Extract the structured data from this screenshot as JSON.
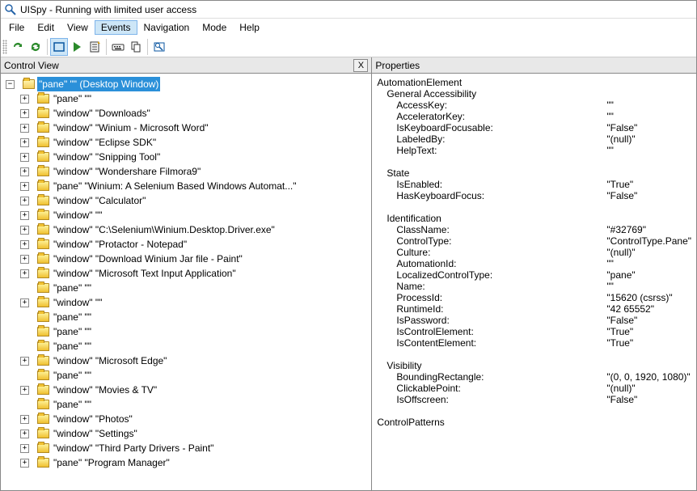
{
  "title": "UISpy - Running with limited user access",
  "menu": {
    "file": "File",
    "edit": "Edit",
    "view": "View",
    "events": "Events",
    "navigation": "Navigation",
    "mode": "Mode",
    "help": "Help",
    "active": "events"
  },
  "toolbar": [
    {
      "name": "refresh-icon",
      "svg": "refresh",
      "color": "#2b8a2b"
    },
    {
      "name": "refresh-all-icon",
      "svg": "refresh2",
      "color": "#2b8a2b"
    },
    {
      "sep": true
    },
    {
      "name": "rect-icon",
      "svg": "rect",
      "color": "#0a56a0",
      "active": true
    },
    {
      "name": "play-icon",
      "svg": "play",
      "color": "#2b8a2b"
    },
    {
      "name": "sheet-icon",
      "svg": "sheet",
      "color": "#333"
    },
    {
      "sep": true
    },
    {
      "name": "keyboard-icon",
      "svg": "keyboard",
      "color": "#333"
    },
    {
      "name": "copy-icon",
      "svg": "copy",
      "color": "#333"
    },
    {
      "sep": true
    },
    {
      "name": "target-icon",
      "svg": "target",
      "color": "#0a56a0"
    }
  ],
  "panes": {
    "left_title": "Control View",
    "right_title": "Properties",
    "close_label": "X"
  },
  "tree": {
    "root": {
      "label": "\"pane\" \"\" (Desktop Window)",
      "selected": true,
      "expanded": true
    },
    "children": [
      {
        "exp": "+",
        "label": "\"pane\" \"\""
      },
      {
        "exp": "+",
        "label": "\"window\" \"Downloads\""
      },
      {
        "exp": "+",
        "label": "\"window\" \"Winium - Microsoft Word\""
      },
      {
        "exp": "+",
        "label": "\"window\" \"Eclipse SDK\""
      },
      {
        "exp": "+",
        "label": "\"window\" \"Snipping Tool\""
      },
      {
        "exp": "+",
        "label": "\"window\" \"Wondershare Filmora9\""
      },
      {
        "exp": "+",
        "label": "\"pane\" \"Winium: A Selenium Based Windows Automat...\""
      },
      {
        "exp": "+",
        "label": "\"window\" \"Calculator\""
      },
      {
        "exp": "+",
        "label": "\"window\" \"\""
      },
      {
        "exp": "+",
        "label": "\"window\" \"C:\\Selenium\\Winium.Desktop.Driver.exe\""
      },
      {
        "exp": "+",
        "label": "\"window\" \"Protactor - Notepad\""
      },
      {
        "exp": "+",
        "label": "\"window\" \"Download Winium Jar file - Paint\""
      },
      {
        "exp": "+",
        "label": "\"window\" \"Microsoft Text Input Application\""
      },
      {
        "exp": "",
        "label": "\"pane\" \"\""
      },
      {
        "exp": "+",
        "label": "\"window\" \"\""
      },
      {
        "exp": "",
        "label": "\"pane\" \"\""
      },
      {
        "exp": "",
        "label": "\"pane\" \"\""
      },
      {
        "exp": "",
        "label": "\"pane\" \"\""
      },
      {
        "exp": "+",
        "label": "\"window\" \"Microsoft Edge\""
      },
      {
        "exp": "",
        "label": "\"pane\" \"\""
      },
      {
        "exp": "+",
        "label": "\"window\" \"Movies & TV\""
      },
      {
        "exp": "",
        "label": "\"pane\" \"\""
      },
      {
        "exp": "+",
        "label": "\"window\" \"Photos\""
      },
      {
        "exp": "+",
        "label": "\"window\" \"Settings\""
      },
      {
        "exp": "+",
        "label": "\"window\" \"Third Party Drivers - Paint\""
      },
      {
        "exp": "+",
        "label": "\"pane\" \"Program Manager\""
      }
    ]
  },
  "properties": {
    "root": "AutomationElement",
    "groups": [
      {
        "title": "General Accessibility",
        "rows": [
          {
            "k": "AccessKey:",
            "v": "\"\""
          },
          {
            "k": "AcceleratorKey:",
            "v": "\"\""
          },
          {
            "k": "IsKeyboardFocusable:",
            "v": "\"False\""
          },
          {
            "k": "LabeledBy:",
            "v": "\"(null)\""
          },
          {
            "k": "HelpText:",
            "v": "\"\""
          }
        ]
      },
      {
        "title": "State",
        "rows": [
          {
            "k": "IsEnabled:",
            "v": "\"True\""
          },
          {
            "k": "HasKeyboardFocus:",
            "v": "\"False\""
          }
        ]
      },
      {
        "title": "Identification",
        "rows": [
          {
            "k": "ClassName:",
            "v": "\"#32769\""
          },
          {
            "k": "ControlType:",
            "v": "\"ControlType.Pane\""
          },
          {
            "k": "Culture:",
            "v": "\"(null)\""
          },
          {
            "k": "AutomationId:",
            "v": "\"\""
          },
          {
            "k": "LocalizedControlType:",
            "v": "\"pane\""
          },
          {
            "k": "Name:",
            "v": "\"\""
          },
          {
            "k": "ProcessId:",
            "v": "\"15620 (csrss)\""
          },
          {
            "k": "RuntimeId:",
            "v": "\"42 65552\""
          },
          {
            "k": "IsPassword:",
            "v": "\"False\""
          },
          {
            "k": "IsControlElement:",
            "v": "\"True\""
          },
          {
            "k": "IsContentElement:",
            "v": "\"True\""
          }
        ]
      },
      {
        "title": "Visibility",
        "rows": [
          {
            "k": "BoundingRectangle:",
            "v": "\"(0, 0, 1920, 1080)\""
          },
          {
            "k": "ClickablePoint:",
            "v": "\"(null)\""
          },
          {
            "k": "IsOffscreen:",
            "v": "\"False\""
          }
        ]
      }
    ],
    "footer": "ControlPatterns"
  }
}
